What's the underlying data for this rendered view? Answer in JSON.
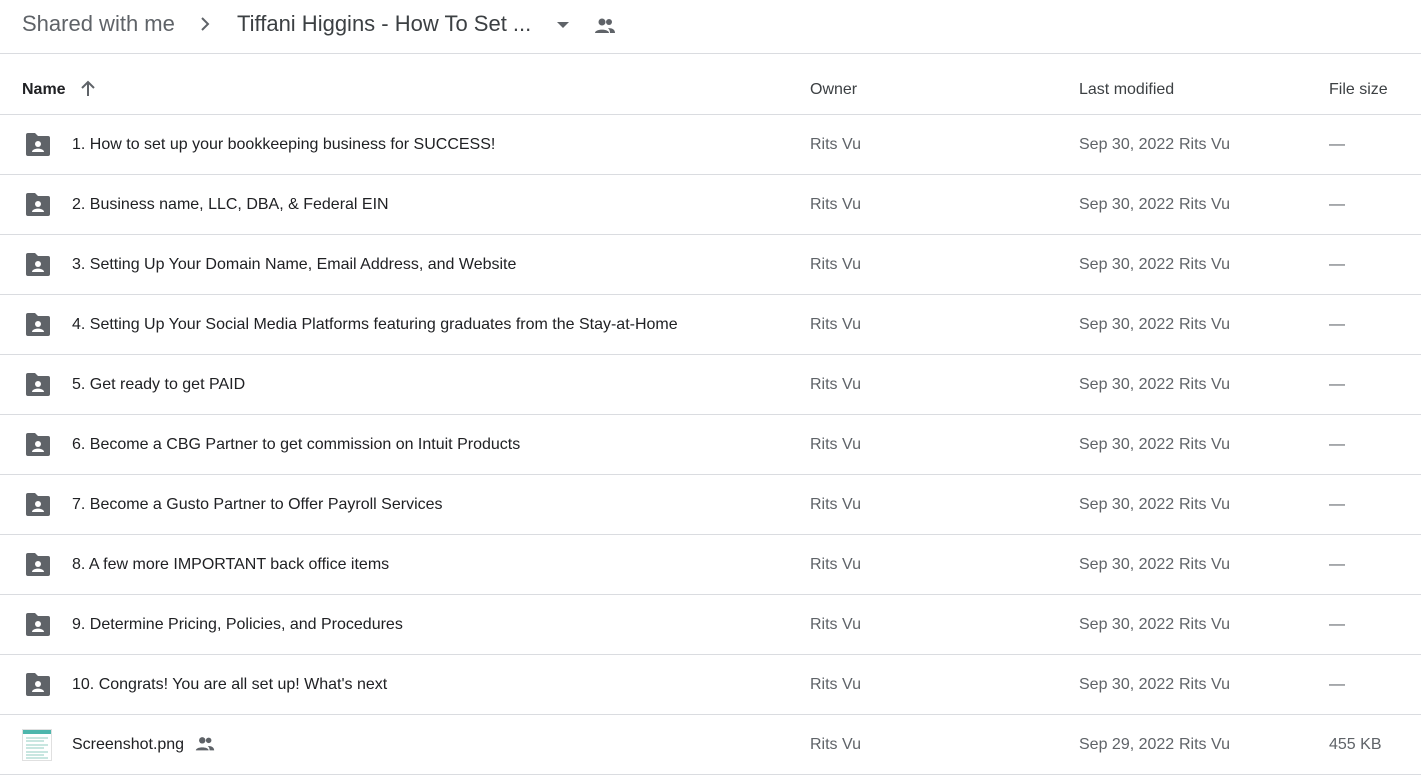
{
  "breadcrumb": {
    "root": "Shared with me",
    "current": "Tiffani Higgins - How To Set ..."
  },
  "columns": {
    "name": "Name",
    "owner": "Owner",
    "last_modified": "Last modified",
    "file_size": "File size"
  },
  "rows": [
    {
      "type": "shared-folder",
      "name": "1. How to set up your bookkeeping business for SUCCESS!",
      "owner": "Rits Vu",
      "date": "Sep 30, 2022",
      "modified_by": "Rits Vu",
      "size": "—"
    },
    {
      "type": "shared-folder",
      "name": "2. Business name, LLC, DBA, & Federal EIN",
      "owner": "Rits Vu",
      "date": "Sep 30, 2022",
      "modified_by": "Rits Vu",
      "size": "—"
    },
    {
      "type": "shared-folder",
      "name": "3. Setting Up Your Domain Name, Email Address, and Website",
      "owner": "Rits Vu",
      "date": "Sep 30, 2022",
      "modified_by": "Rits Vu",
      "size": "—"
    },
    {
      "type": "shared-folder",
      "name": "4. Setting Up Your Social Media Platforms featuring graduates from the Stay-at-Home",
      "owner": "Rits Vu",
      "date": "Sep 30, 2022",
      "modified_by": "Rits Vu",
      "size": "—"
    },
    {
      "type": "shared-folder",
      "name": "5. Get ready to get PAID",
      "owner": "Rits Vu",
      "date": "Sep 30, 2022",
      "modified_by": "Rits Vu",
      "size": "—"
    },
    {
      "type": "shared-folder",
      "name": "6. Become a CBG Partner to get commission on Intuit Products",
      "owner": "Rits Vu",
      "date": "Sep 30, 2022",
      "modified_by": "Rits Vu",
      "size": "—"
    },
    {
      "type": "shared-folder",
      "name": "7. Become a Gusto Partner to Offer Payroll Services",
      "owner": "Rits Vu",
      "date": "Sep 30, 2022",
      "modified_by": "Rits Vu",
      "size": "—"
    },
    {
      "type": "shared-folder",
      "name": "8. A few more IMPORTANT back office items",
      "owner": "Rits Vu",
      "date": "Sep 30, 2022",
      "modified_by": "Rits Vu",
      "size": "—"
    },
    {
      "type": "shared-folder",
      "name": "9. Determine Pricing, Policies, and Procedures",
      "owner": "Rits Vu",
      "date": "Sep 30, 2022",
      "modified_by": "Rits Vu",
      "size": "—"
    },
    {
      "type": "shared-folder",
      "name": "10. Congrats! You are all set up! What's next",
      "owner": "Rits Vu",
      "date": "Sep 30, 2022",
      "modified_by": "Rits Vu",
      "size": "—"
    },
    {
      "type": "image-file",
      "name": "Screenshot.png",
      "owner": "Rits Vu",
      "date": "Sep 29, 2022",
      "modified_by": "Rits Vu",
      "size": "455 KB",
      "shared": true
    }
  ],
  "icons": {
    "folder": "shared-folder-icon",
    "people": "people-icon",
    "sort": "arrow-up-icon",
    "dropdown": "caret-down-icon",
    "separator": "chevron-right-icon"
  },
  "colors": {
    "icon_gray": "#5f6368",
    "divider": "#dadce0",
    "text_primary": "#202124",
    "text_secondary": "#5f6368"
  }
}
